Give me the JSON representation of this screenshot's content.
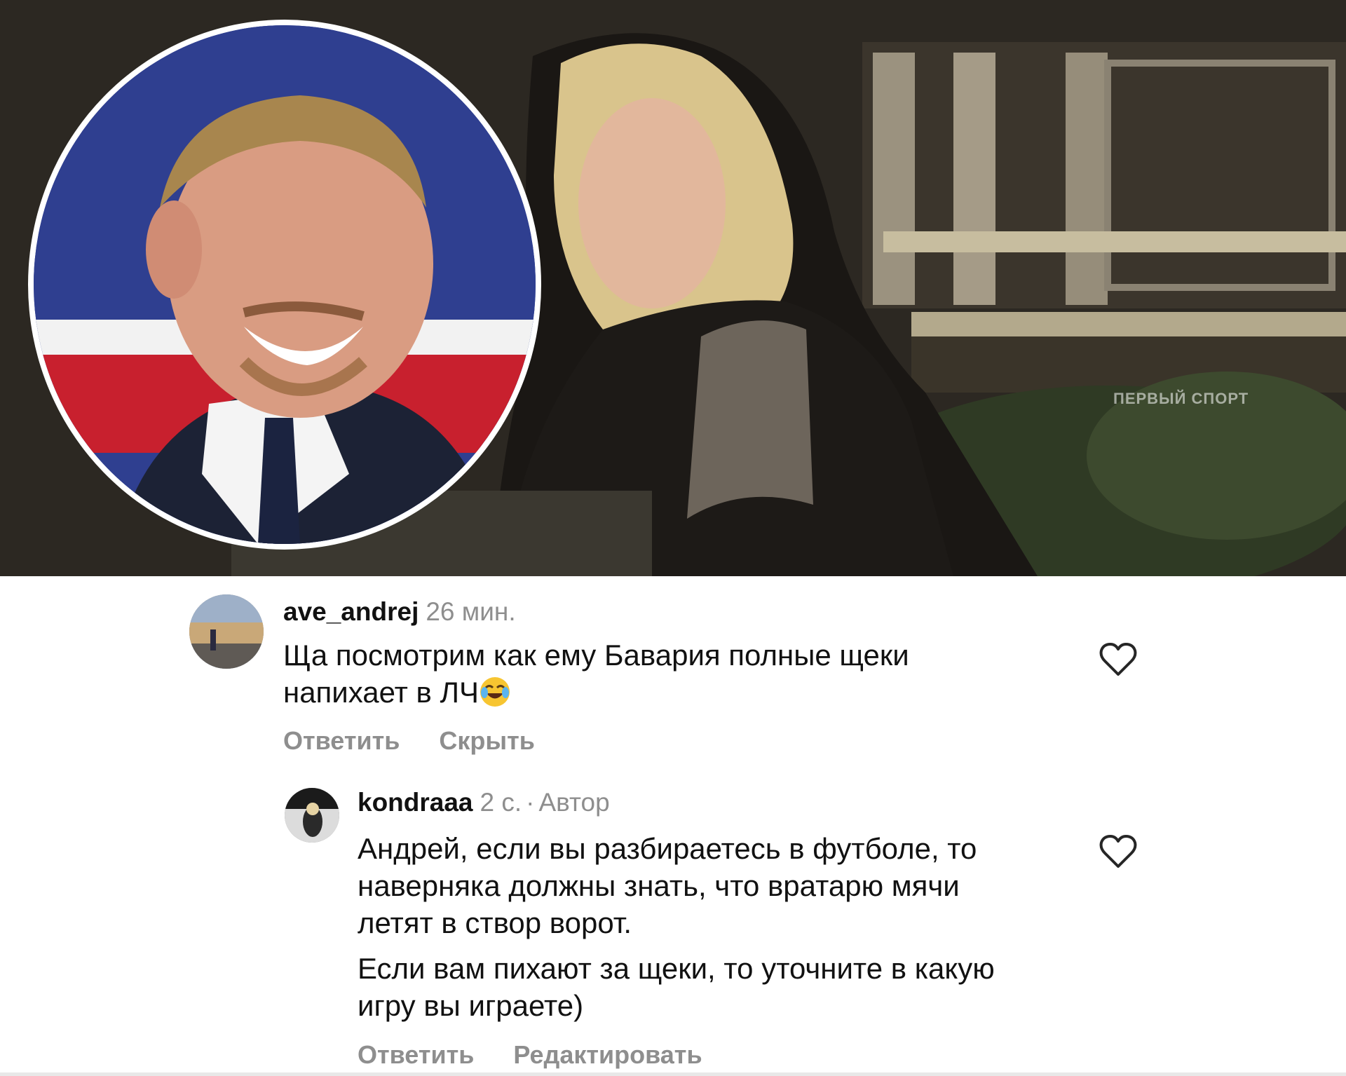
{
  "hero": {
    "watermark": "ПЕРВЫЙ СПОРТ"
  },
  "comments": [
    {
      "username": "ave_andrej",
      "time": "26 мин.",
      "text": "Ща посмотрим как ему Бавария полные щеки напихает в ЛЧ",
      "emoji": "face-with-tears-of-joy",
      "actions": {
        "reply": "Ответить",
        "secondary": "Скрыть"
      },
      "liked": false
    },
    {
      "username": "kondraaa",
      "time": "2 с.",
      "separator": "·",
      "role": "Автор",
      "paragraphs": [
        "Андрей, если вы разбираетесь в футболе, то наверняка должны знать, что вратарю мячи летят в створ ворот.",
        "Если вам пихают за щеки, то уточните в какую игру вы играете)"
      ],
      "actions": {
        "reply": "Ответить",
        "secondary": "Редактировать"
      },
      "liked": false
    }
  ],
  "icons": {
    "like": "heart-outline-icon"
  },
  "colors": {
    "muted_text": "#8e8e8e",
    "primary_text": "#111111",
    "inset_border": "#ffffff"
  }
}
